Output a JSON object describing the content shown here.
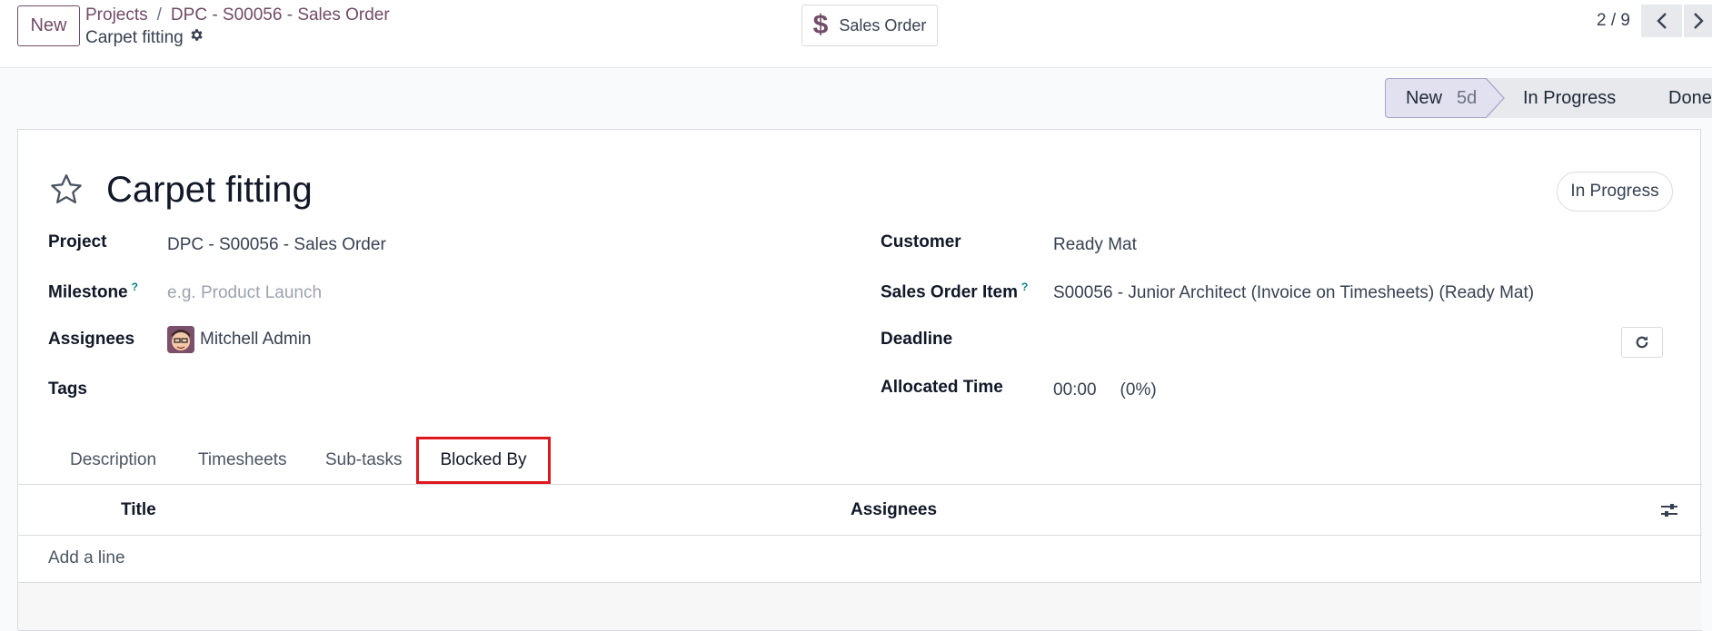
{
  "header": {
    "new_button": "New",
    "breadcrumb": [
      "Projects",
      "DPC - S00056 - Sales Order"
    ],
    "breadcrumb_separator": "/",
    "record_name": "Carpet fitting",
    "smart_button": {
      "icon": "dollar-icon",
      "label": "Sales Order"
    },
    "pager": "2 / 9"
  },
  "status_bar": {
    "stages": [
      {
        "label": "New",
        "duration": "5d",
        "active": true
      },
      {
        "label": "In Progress",
        "active": false
      },
      {
        "label": "Done",
        "active": false
      }
    ]
  },
  "form": {
    "title": "Carpet fitting",
    "state_button": "In Progress",
    "left_fields": {
      "project": {
        "label": "Project",
        "value": "DPC - S00056 - Sales Order"
      },
      "milestone": {
        "label": "Milestone",
        "help": "?",
        "placeholder": "e.g. Product Launch"
      },
      "assignees": {
        "label": "Assignees",
        "value": "Mitchell Admin"
      },
      "tags": {
        "label": "Tags"
      }
    },
    "right_fields": {
      "customer": {
        "label": "Customer",
        "value": "Ready Mat"
      },
      "sales_order_item": {
        "label": "Sales Order Item",
        "help": "?",
        "value": "S00056 - Junior Architect (Invoice on Timesheets) (Ready Mat)"
      },
      "deadline": {
        "label": "Deadline"
      },
      "allocated_time": {
        "label": "Allocated Time",
        "value": "00:00",
        "percent": "(0%)"
      }
    }
  },
  "tabs": [
    "Description",
    "Timesheets",
    "Sub-tasks",
    "Blocked By"
  ],
  "active_tab": "Blocked By",
  "list": {
    "columns": [
      "Title",
      "Assignees"
    ],
    "add_line": "Add a line"
  },
  "colors": {
    "brand": "#714b67",
    "help": "#017e84",
    "highlight": "#e0161e"
  }
}
